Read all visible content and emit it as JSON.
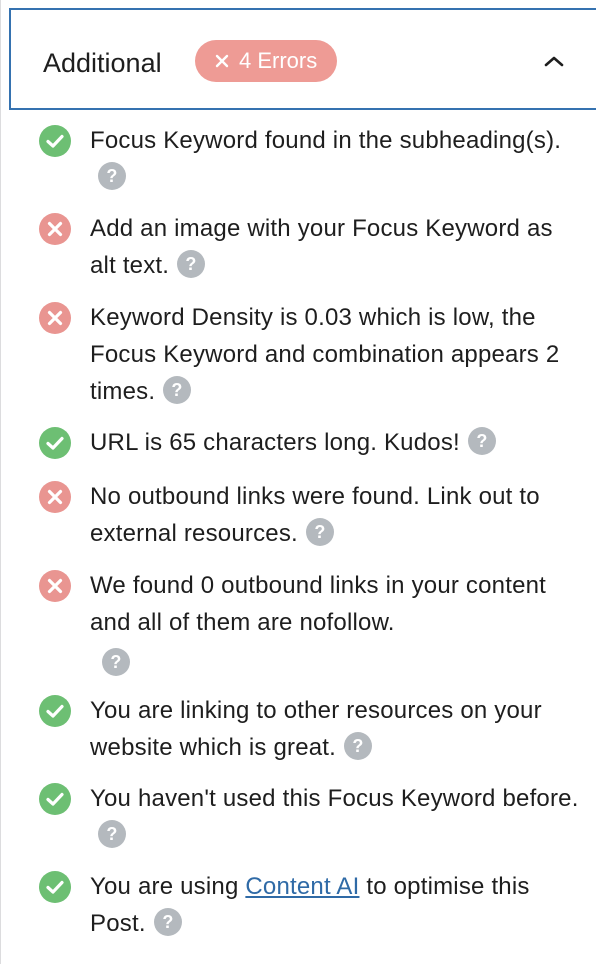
{
  "header": {
    "title": "Additional",
    "errors_badge": "4 Errors",
    "badge_color": "#ee9b95",
    "toggle_icon": "chevron-up-icon"
  },
  "colors": {
    "pass": "#6dbf73",
    "fail": "#e99591",
    "help": "#b4b9be",
    "link": "#2f6aa6",
    "active_border": "#3572b0"
  },
  "checks": [
    {
      "status": "pass",
      "text": "Focus Keyword found in the subheading(s)."
    },
    {
      "status": "fail",
      "text": "Add an image with your Focus Keyword as alt text."
    },
    {
      "status": "fail",
      "text": "Keyword Density is 0.03 which is low, the Focus Keyword and combination appears 2 times."
    },
    {
      "status": "pass",
      "text": "URL is 65 characters long. Kudos!"
    },
    {
      "status": "fail",
      "text": "No outbound links were found. Link out to external resources."
    },
    {
      "status": "fail",
      "text": "We found 0 outbound links in your content and all of them are nofollow."
    },
    {
      "status": "pass",
      "text": "You are linking to other resources on your website which is great."
    },
    {
      "status": "pass",
      "text": "You haven't used this Focus Keyword before."
    },
    {
      "status": "pass",
      "text_before": "You are using ",
      "link_text": "Content AI",
      "text_after": " to optimise this Post."
    }
  ]
}
